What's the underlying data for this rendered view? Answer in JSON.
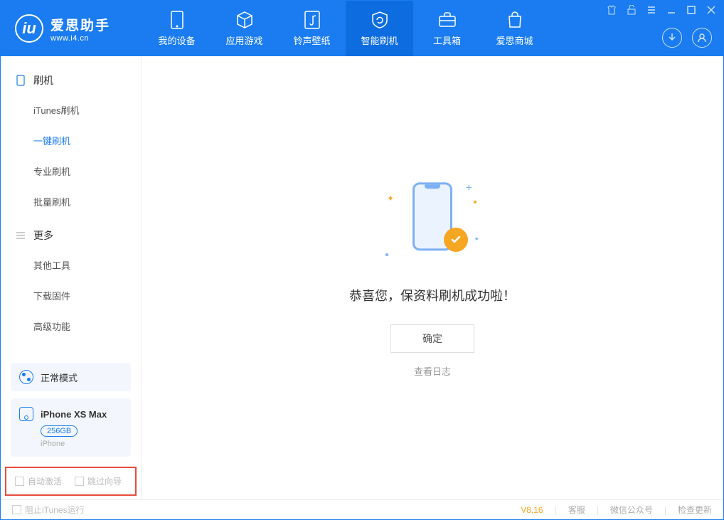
{
  "app": {
    "title": "爱思助手",
    "subtitle": "www.i4.cn"
  },
  "nav": {
    "tabs": [
      {
        "label": "我的设备"
      },
      {
        "label": "应用游戏"
      },
      {
        "label": "铃声壁纸"
      },
      {
        "label": "智能刷机"
      },
      {
        "label": "工具箱"
      },
      {
        "label": "爱思商城"
      }
    ]
  },
  "sidebar": {
    "group1": {
      "label": "刷机",
      "items": [
        {
          "label": "iTunes刷机"
        },
        {
          "label": "一键刷机"
        },
        {
          "label": "专业刷机"
        },
        {
          "label": "批量刷机"
        }
      ]
    },
    "group2": {
      "label": "更多",
      "items": [
        {
          "label": "其他工具"
        },
        {
          "label": "下载固件"
        },
        {
          "label": "高级功能"
        }
      ]
    },
    "mode": {
      "label": "正常模式"
    },
    "device": {
      "name": "iPhone XS Max",
      "storage": "256GB",
      "type": "iPhone"
    },
    "checks": {
      "chk1": "自动激活",
      "chk2": "跳过向导"
    }
  },
  "main": {
    "success_msg": "恭喜您，保资料刷机成功啦！",
    "confirm": "确定",
    "log_link": "查看日志"
  },
  "footer": {
    "itunes_block": "阻止iTunes运行",
    "version": "V8.16",
    "link1": "客服",
    "link2": "微信公众号",
    "link3": "检查更新"
  }
}
